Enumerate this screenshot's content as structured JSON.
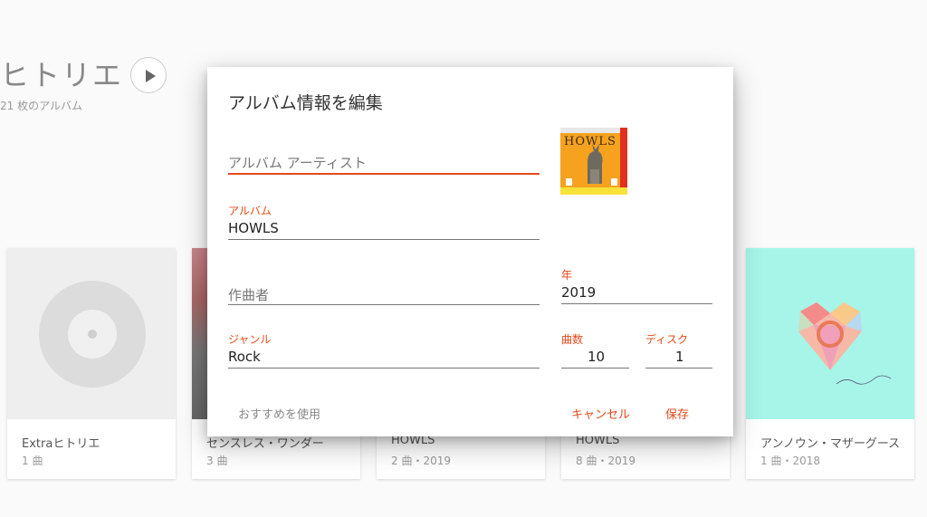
{
  "artist": {
    "name": "ヒトリエ",
    "album_count": "21 枚のアルバム"
  },
  "cards": [
    {
      "title": "Extraヒトリエ",
      "meta": "1 曲"
    },
    {
      "title": "センスレス・ワンダー",
      "meta": "3 曲"
    },
    {
      "title": "HOWLS",
      "meta": "2 曲・2019"
    },
    {
      "title": "HOWLS",
      "meta": "8 曲・2019"
    },
    {
      "title": "アンノウン・マザーグース",
      "meta": "1 曲・2018"
    }
  ],
  "dialog": {
    "title": "アルバム情報を編集",
    "album_artist_placeholder": "アルバム アーティスト",
    "album_label": "アルバム",
    "album_value": "HOWLS",
    "composer_placeholder": "作曲者",
    "year_label": "年",
    "year_value": "2019",
    "genre_label": "ジャンル",
    "genre_value": "Rock",
    "tracks_label": "曲数",
    "tracks_value": "10",
    "disc_label": "ディスク",
    "disc_value": "1",
    "cover_text": "HOWLS",
    "recommend_label": "おすすめを使用",
    "cancel_label": "キャンセル",
    "save_label": "保存"
  },
  "colors": {
    "accent": "#e64a19",
    "background": "#fafafa",
    "card_teal": "#a6f5e8"
  }
}
